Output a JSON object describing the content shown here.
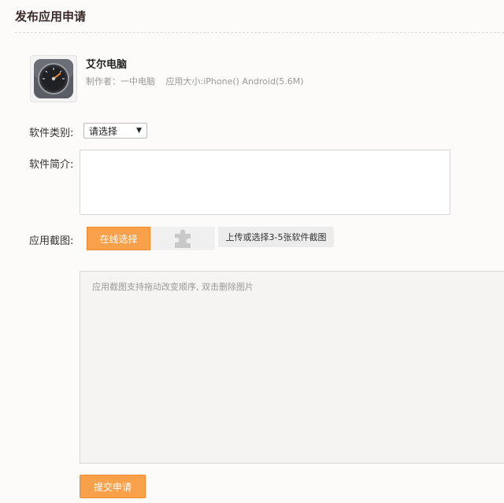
{
  "page": {
    "title": "发布应用申请"
  },
  "app": {
    "name": "艾尔电脑",
    "author": "制作者：一中电脑",
    "size": "应用大小:iPhone() Android(5.6M)",
    "icon": "speedometer-icon"
  },
  "form": {
    "category_label": "软件类别:",
    "category_value": "请选择",
    "intro_label": "软件简介:",
    "intro_value": "",
    "screenshot_label": "应用截图:",
    "online_select_label": "在线选择",
    "upload_hint": "上传或选择3-5张软件截图",
    "screenshot_hint": "应用截图支持拖动改变顺序, 双击删除图片",
    "submit_label": "提交申请"
  },
  "colors": {
    "accent": "#f9a04a",
    "background": "#fcfbfa"
  }
}
